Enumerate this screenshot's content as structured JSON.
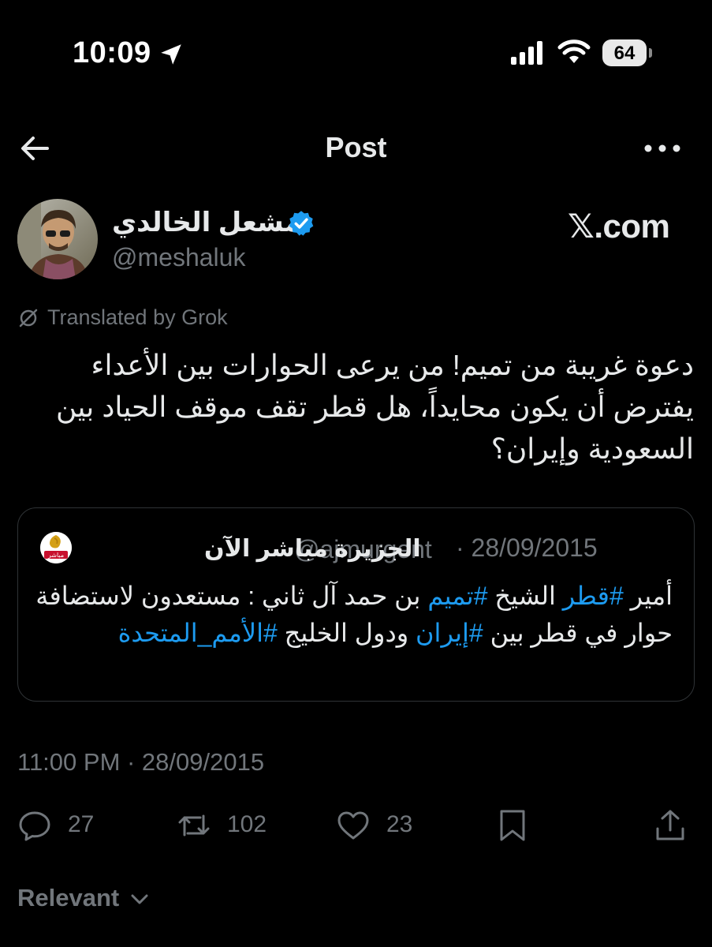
{
  "status_bar": {
    "time": "10:09",
    "battery": "64"
  },
  "header": {
    "title": "Post"
  },
  "author": {
    "name": "مشعل الخالدي",
    "handle": "@meshaluk"
  },
  "site_label": "𝕏.com",
  "translated_label": "Translated by Grok",
  "post": {
    "text": "دعوة غريبة من تميم! من يرعى الحوارات بين الأعداء يفترض أن يكون محايداً، هل قطر تقف موقف الحياد بين السعودية وإيران؟"
  },
  "quote": {
    "name": "الجزيرة مباشر الآن",
    "handle": "@ajmurgent",
    "date": "· 28/09/2015",
    "logo_text": "مباشر",
    "text_parts": [
      "أمير ",
      "#قطر",
      " الشيخ  ",
      "#تميم",
      " بن حمد آل ثاني : مستعدون لاستضافة حوار في قطر بين ",
      "#إيران",
      " ودول الخليج ",
      "#الأمم_المتحدة"
    ]
  },
  "timestamp": "11:00 PM · 28/09/2015",
  "actions": {
    "replies": "27",
    "reposts": "102",
    "likes": "23"
  },
  "sort": {
    "label": "Relevant"
  },
  "colors": {
    "background": "#000000",
    "text": "#e7e9ea",
    "muted": "#71767b",
    "link": "#1d9bf0",
    "verified": "#1d9bf0"
  },
  "icons": [
    "location-arrow-icon",
    "signal-icon",
    "wifi-icon",
    "battery-icon",
    "back-arrow-icon",
    "more-icon",
    "verified-icon",
    "translate-icon",
    "reply-icon",
    "repost-icon",
    "like-icon",
    "bookmark-icon",
    "share-icon",
    "chevron-down-icon"
  ]
}
